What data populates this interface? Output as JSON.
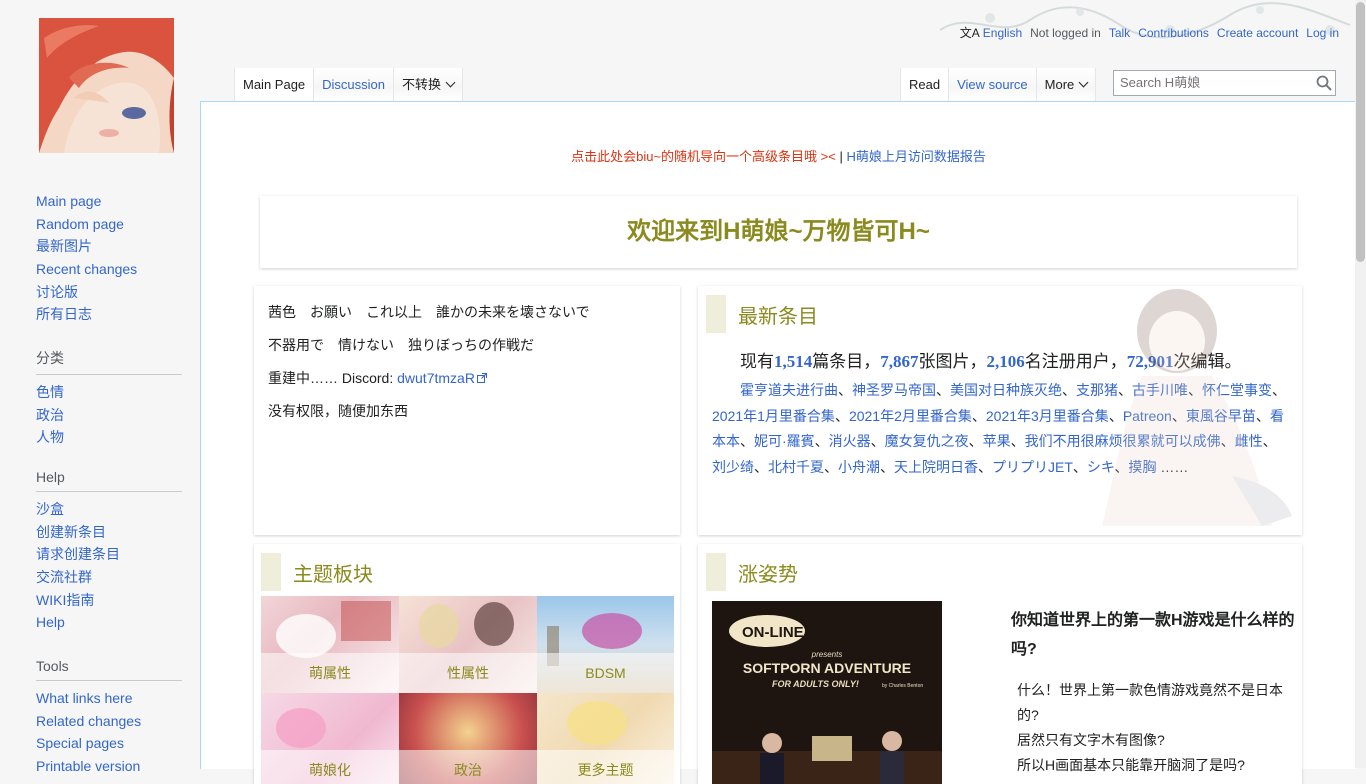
{
  "header": {
    "language": "English",
    "not_logged_in": "Not logged in",
    "talk": "Talk",
    "contributions": "Contributions",
    "create_account": "Create account",
    "login": "Log in"
  },
  "tabs": {
    "left": [
      "Main Page",
      "Discussion",
      "不转换"
    ],
    "right": [
      "Read",
      "View source",
      "More"
    ]
  },
  "search": {
    "placeholder": "Search H萌娘"
  },
  "sidebar": {
    "nav": [
      "Main page",
      "Random page",
      "最新图片",
      "Recent changes",
      "讨论版",
      "所有日志"
    ],
    "categories_heading": "分类",
    "categories": [
      "色情",
      "政治",
      "人物"
    ],
    "help_heading": "Help",
    "help": [
      "沙盒",
      "创建新条目",
      "请求创建条目",
      "交流社群",
      "WIKI指南",
      "Help"
    ],
    "tools_heading": "Tools",
    "tools": [
      "What links here",
      "Related changes",
      "Special pages",
      "Printable version"
    ]
  },
  "notice": {
    "random_link": "点击此处会biu~的随机导向一个高级条目哦 ><",
    "separator": "|",
    "report_link": "H萌娘上月访问数据报告"
  },
  "welcome": "欢迎来到H萌娘~万物皆可H~",
  "intro": {
    "line1": "茜色　お願い　これ以上　誰かの未来を壊さないで",
    "line2": "不器用で　情けない　独りぼっちの作戦だ",
    "line3_prefix": "重建中…… Discord: ",
    "line3_link": "dwut7tmzaR",
    "line4": "没有权限，随便加东西"
  },
  "latest": {
    "title": "最新条目",
    "stats": {
      "p1": "现有",
      "articles": "1,514",
      "p2": "篇条目，",
      "images": "7,867",
      "p3": "张图片，",
      "users": "2,106",
      "p4": "名注册用户，",
      "edits": "72,901",
      "p5": "次编辑。"
    },
    "links": [
      "霍亨道夫进行曲",
      "神圣罗马帝国",
      "美国对日种族灭绝",
      "支那猪",
      "古手川唯",
      "怀仁堂事变",
      "2021年1月里番合集",
      "2021年2月里番合集",
      "2021年3月里番合集",
      "Patreon",
      "東風谷早苗",
      "看本本",
      "妮可·羅賓",
      "消火器",
      "魔女复仇之夜",
      "苹果",
      "我们不用很麻烦很累就可以成佛",
      "雌性",
      "刘少绮",
      "北村千夏",
      "小舟潮",
      "天上院明日香",
      "プリプリJET",
      "シキ",
      "摸胸"
    ],
    "ellipsis": "……"
  },
  "topics": {
    "title": "主题板块",
    "items": [
      "萌属性",
      "性属性",
      "BDSM",
      "萌娘化",
      "政治",
      "更多主题"
    ]
  },
  "pose": {
    "title": "涨姿势",
    "question": "你知道世界上的第一款H游戏是什么样的吗?",
    "lines": [
      "什么！世界上第一款色情游戏竟然不是日本的?",
      "居然只有文字木有图像?",
      "所以H画面基本只能靠开脑洞了是吗?"
    ],
    "cover": {
      "brand": "ON-LINE systems",
      "presents": "presents",
      "title": "SOFTPORN ADVENTURE",
      "subtitle": "FOR ADULTS ONLY!",
      "author": "by Charles Benton"
    }
  },
  "colors": {
    "link": "#3366cc",
    "title_olive": "#8a8a1e",
    "notice_red": "#dd3311"
  }
}
